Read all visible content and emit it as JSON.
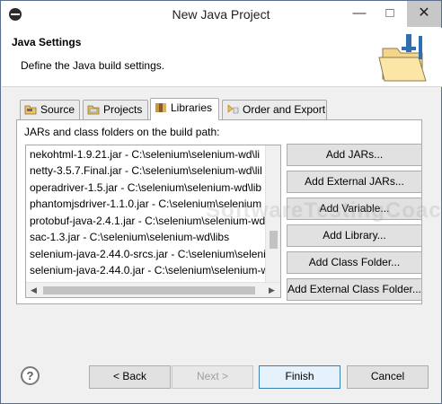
{
  "window": {
    "title": "New Java Project",
    "controls": {
      "minimize": "—",
      "maximize": "□",
      "close": "✕"
    }
  },
  "header": {
    "title": "Java Settings",
    "description": "Define the Java build settings."
  },
  "tabs": [
    {
      "label": "Source",
      "icon": "source-folder-icon"
    },
    {
      "label": "Projects",
      "icon": "projects-folder-icon"
    },
    {
      "label": "Libraries",
      "icon": "libraries-icon",
      "active": true
    },
    {
      "label": "Order and Export",
      "icon": "order-export-icon"
    }
  ],
  "libraries": {
    "list_label": "JARs and class folders on the build path:",
    "items": [
      "nekohtml-1.9.21.jar - C:\\selenium\\selenium-wd\\li",
      "netty-3.5.7.Final.jar - C:\\selenium\\selenium-wd\\lil",
      "operadriver-1.5.jar - C:\\selenium\\selenium-wd\\lib",
      "phantomjsdriver-1.1.0.jar - C:\\selenium\\selenium",
      "protobuf-java-2.4.1.jar - C:\\selenium\\selenium-wd",
      "sac-1.3.jar - C:\\selenium\\selenium-wd\\libs",
      "selenium-java-2.44.0-srcs.jar - C:\\selenium\\seleni",
      "selenium-java-2.44.0.jar - C:\\selenium\\selenium-w"
    ],
    "buttons": {
      "add_jars": "Add JARs...",
      "add_external_jars": "Add External JARs...",
      "add_variable": "Add Variable...",
      "add_library": "Add Library...",
      "add_class_folder": "Add Class Folder...",
      "add_external_class_folder": "Add External Class Folder..."
    }
  },
  "watermark": "SoftwareTestingCoach",
  "footer": {
    "help": "?",
    "back": "< Back",
    "next": "Next >",
    "finish": "Finish",
    "cancel": "Cancel"
  }
}
